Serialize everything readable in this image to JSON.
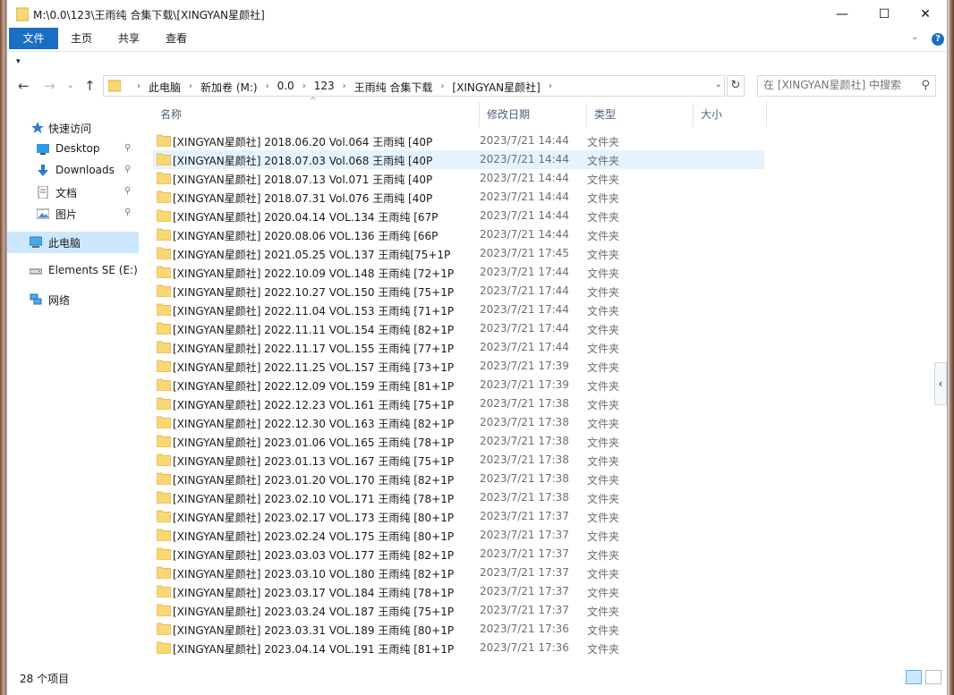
{
  "window": {
    "title": "M:\\0.0\\123\\王雨纯 合集下载\\[XINGYAN星颜社]",
    "minimize_label": "—",
    "maximize_label": "☐",
    "close_label": "✕"
  },
  "ribbon": {
    "tabs": [
      "文件",
      "主页",
      "共享",
      "查看"
    ],
    "help_label": "?"
  },
  "address": {
    "crumbs": [
      "此电脑",
      "新加卷 (M:)",
      "0.0",
      "123",
      "王雨纯 合集下载",
      "[XINGYAN星颜社]"
    ]
  },
  "search": {
    "placeholder": "在 [XINGYAN星颜社] 中搜索"
  },
  "sidebar": {
    "items": [
      {
        "label": "快速访问",
        "icon": "star-icon"
      },
      {
        "label": "Desktop",
        "icon": "desktop-icon",
        "pinned": true
      },
      {
        "label": "Downloads",
        "icon": "download-icon",
        "pinned": true
      },
      {
        "label": "文档",
        "icon": "document-icon",
        "pinned": true
      },
      {
        "label": "图片",
        "icon": "picture-icon",
        "pinned": true
      },
      {
        "label": "此电脑",
        "icon": "computer-icon",
        "selected": true
      },
      {
        "label": "Elements SE (E:)",
        "icon": "drive-icon"
      },
      {
        "label": "网络",
        "icon": "network-icon"
      }
    ]
  },
  "columns": {
    "name": "名称",
    "date": "修改日期",
    "type": "类型",
    "size": "大小"
  },
  "files": [
    {
      "name": "[XINGYAN星颜社] 2018.06.20 Vol.064 王雨纯 [40P",
      "date": "2023/7/21 14:44",
      "type": "文件夹"
    },
    {
      "name": "[XINGYAN星颜社] 2018.07.03 Vol.068 王雨纯 [40P",
      "date": "2023/7/21 14:44",
      "type": "文件夹"
    },
    {
      "name": "[XINGYAN星颜社] 2018.07.13 Vol.071 王雨纯 [40P",
      "date": "2023/7/21 14:44",
      "type": "文件夹"
    },
    {
      "name": "[XINGYAN星颜社] 2018.07.31 Vol.076 王雨纯 [40P",
      "date": "2023/7/21 14:44",
      "type": "文件夹"
    },
    {
      "name": "[XINGYAN星颜社] 2020.04.14 VOL.134 王雨纯 [67P",
      "date": "2023/7/21 14:44",
      "type": "文件夹"
    },
    {
      "name": "[XINGYAN星颜社] 2020.08.06 VOL.136 王雨纯 [66P",
      "date": "2023/7/21 14:44",
      "type": "文件夹"
    },
    {
      "name": "[XINGYAN星颜社] 2021.05.25 VOL.137 王雨纯[75+1P",
      "date": "2023/7/21 17:45",
      "type": "文件夹"
    },
    {
      "name": "[XINGYAN星颜社] 2022.10.09 VOL.148 王雨纯 [72+1P",
      "date": "2023/7/21 17:44",
      "type": "文件夹"
    },
    {
      "name": "[XINGYAN星颜社] 2022.10.27 VOL.150 王雨纯 [75+1P",
      "date": "2023/7/21 17:44",
      "type": "文件夹"
    },
    {
      "name": "[XINGYAN星颜社] 2022.11.04 VOL.153 王雨纯 [71+1P",
      "date": "2023/7/21 17:44",
      "type": "文件夹"
    },
    {
      "name": "[XINGYAN星颜社] 2022.11.11 VOL.154 王雨纯 [82+1P",
      "date": "2023/7/21 17:44",
      "type": "文件夹"
    },
    {
      "name": "[XINGYAN星颜社] 2022.11.17 VOL.155 王雨纯 [77+1P",
      "date": "2023/7/21 17:44",
      "type": "文件夹"
    },
    {
      "name": "[XINGYAN星颜社] 2022.11.25 VOL.157 王雨纯 [73+1P",
      "date": "2023/7/21 17:39",
      "type": "文件夹"
    },
    {
      "name": "[XINGYAN星颜社] 2022.12.09 VOL.159 王雨纯 [81+1P",
      "date": "2023/7/21 17:39",
      "type": "文件夹"
    },
    {
      "name": "[XINGYAN星颜社] 2022.12.23 VOL.161 王雨纯 [75+1P",
      "date": "2023/7/21 17:38",
      "type": "文件夹"
    },
    {
      "name": "[XINGYAN星颜社] 2022.12.30 VOL.163 王雨纯 [82+1P",
      "date": "2023/7/21 17:38",
      "type": "文件夹"
    },
    {
      "name": "[XINGYAN星颜社] 2023.01.06 VOL.165 王雨纯 [78+1P",
      "date": "2023/7/21 17:38",
      "type": "文件夹"
    },
    {
      "name": "[XINGYAN星颜社] 2023.01.13 VOL.167 王雨纯 [75+1P",
      "date": "2023/7/21 17:38",
      "type": "文件夹"
    },
    {
      "name": "[XINGYAN星颜社] 2023.01.20 VOL.170 王雨纯 [82+1P",
      "date": "2023/7/21 17:38",
      "type": "文件夹"
    },
    {
      "name": "[XINGYAN星颜社] 2023.02.10 VOL.171 王雨纯 [78+1P",
      "date": "2023/7/21 17:38",
      "type": "文件夹"
    },
    {
      "name": "[XINGYAN星颜社] 2023.02.17 VOL.173 王雨纯 [80+1P",
      "date": "2023/7/21 17:37",
      "type": "文件夹"
    },
    {
      "name": "[XINGYAN星颜社] 2023.02.24 VOL.175 王雨纯 [80+1P",
      "date": "2023/7/21 17:37",
      "type": "文件夹"
    },
    {
      "name": "[XINGYAN星颜社] 2023.03.03 VOL.177 王雨纯 [82+1P",
      "date": "2023/7/21 17:37",
      "type": "文件夹"
    },
    {
      "name": "[XINGYAN星颜社] 2023.03.10 VOL.180 王雨纯 [82+1P",
      "date": "2023/7/21 17:37",
      "type": "文件夹"
    },
    {
      "name": "[XINGYAN星颜社] 2023.03.17 VOL.184 王雨纯 [78+1P",
      "date": "2023/7/21 17:37",
      "type": "文件夹"
    },
    {
      "name": "[XINGYAN星颜社] 2023.03.24 VOL.187 王雨纯 [75+1P",
      "date": "2023/7/21 17:37",
      "type": "文件夹"
    },
    {
      "name": "[XINGYAN星颜社] 2023.03.31 VOL.189 王雨纯 [80+1P",
      "date": "2023/7/21 17:36",
      "type": "文件夹"
    },
    {
      "name": "[XINGYAN星颜社] 2023.04.14 VOL.191 王雨纯 [81+1P",
      "date": "2023/7/21 17:36",
      "type": "文件夹"
    }
  ],
  "hovered_row": 1,
  "status": {
    "count_text": "28 个项目"
  },
  "colors": {
    "accent": "#1a6fc4",
    "folder": "#f8d775",
    "selection": "#cce8ff",
    "hover": "#e5f3ff"
  }
}
